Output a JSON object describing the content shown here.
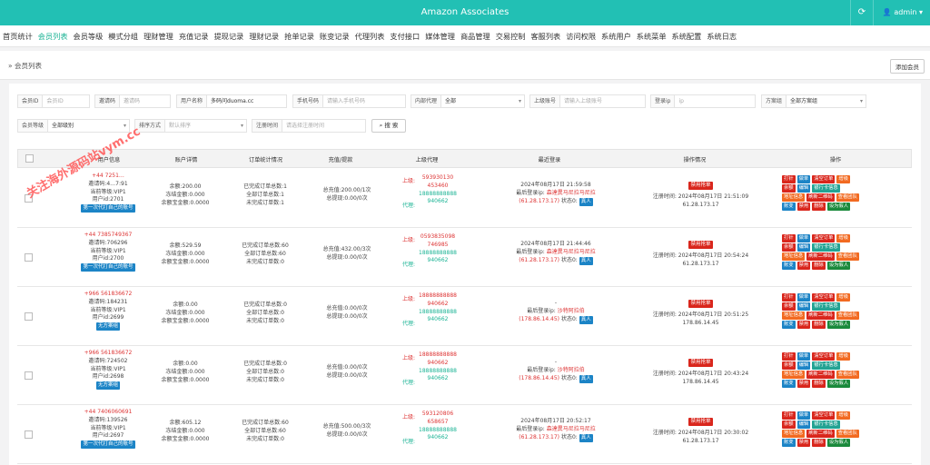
{
  "header": {
    "title": "Amazon Associates",
    "user": "admin",
    "refresh_icon": "refresh-icon",
    "user_icon": "user-icon"
  },
  "nav": [
    "首页统计",
    "会员列表",
    "会员等级",
    "模式分组",
    "理财管理",
    "充值记录",
    "提现记录",
    "理财记录",
    "抢单记录",
    "账变记录",
    "代理列表",
    "支付接口",
    "媒体管理",
    "商品管理",
    "交易控制",
    "客服列表",
    "访问权限",
    "系统用户",
    "系统菜单",
    "系统配置",
    "系统日志"
  ],
  "nav_active": 1,
  "breadcrumb": {
    "title": "会员列表",
    "add_button": "添加会员"
  },
  "filters": {
    "member_id": {
      "label": "会员ID",
      "placeholder": "会员ID"
    },
    "invite_code": {
      "label": "邀请码",
      "placeholder": "邀请码"
    },
    "user_name": {
      "label": "用户名称",
      "value": "多码问duoma.cc"
    },
    "phone": {
      "label": "手机号码",
      "placeholder": "请输入手机号码"
    },
    "internal_agent": {
      "label": "内部代理",
      "value": "全部"
    },
    "parent_phone": {
      "label": "上级账号",
      "placeholder": "请输入上级账号"
    },
    "login_ip": {
      "label": "登录ip",
      "placeholder": "ip"
    },
    "plan_group": {
      "label": "方案组",
      "value": "全部方案组"
    },
    "member_level": {
      "label": "会员等级",
      "value": "全部级别"
    },
    "sort": {
      "label": "排序方式",
      "placeholder": "默认排序"
    },
    "reg_time": {
      "label": "注册时间",
      "placeholder": "请选择注册时间"
    },
    "search_button": "搜 索"
  },
  "columns": [
    "用户信息",
    "账户详情",
    "订单统计情况",
    "充值/提款",
    "上级代理",
    "最近登录",
    "操作情况",
    "操作"
  ],
  "watermark": "关注海外源码站vym.cc",
  "rows": [
    {
      "phone": "+44 7251…",
      "invite": "邀请码:4…7:91",
      "level": "当前等级:VIP1",
      "uid": "用户id:2701",
      "tag": "第一次代打自己的账号",
      "acct": [
        "余额:200.00",
        "冻结金额:0.000",
        "余额宝金额:0.0000"
      ],
      "orders": [
        "已完成订单总数:1",
        "全部订单总数:1",
        "未完成订单数:1"
      ],
      "money": [
        "总充值:200.00/1次",
        "总提现:0.00/0次"
      ],
      "parent": [
        "593930130",
        "453460"
      ],
      "agent": [
        "18888888888",
        "940662"
      ],
      "last": "2024年08月17日 21:59:58",
      "login_ip": "森達異马尼拉马尼拉",
      "ip": "(61.28.173.17)",
      "state": "状态0:",
      "state_tag": "真人",
      "ban": "禁用抢单",
      "reg": "注册时间: 2024年08月17日 21:51:09",
      "reg_ip": "61.28.173.17"
    },
    {
      "phone": "+44 7385749367",
      "invite": "邀请码:706296",
      "level": "当前等级:VIP1",
      "uid": "用户id:2700",
      "tag": "第一次代打自己的账号",
      "acct": [
        "余额:529.59",
        "冻结金额:0.000",
        "余额宝金额:0.0000"
      ],
      "orders": [
        "已完成订单总数:60",
        "全部订单总数:60",
        "未完成订单数:0"
      ],
      "money": [
        "总充值:432.00/3次",
        "总提现:0.00/0次"
      ],
      "parent": [
        "0593835098",
        "746985"
      ],
      "agent": [
        "18888888888",
        "940662"
      ],
      "last": "2024年08月17日 21:44:46",
      "login_ip": "森達異马尼拉马尼拉",
      "ip": "(61.28.173.17)",
      "state": "状态0:",
      "state_tag": "真人",
      "ban": "禁用抢单",
      "reg": "注册时间: 2024年08月17日 20:54:24",
      "reg_ip": "61.28.173.17"
    },
    {
      "phone": "+966 561836672",
      "invite": "邀请码:184231",
      "level": "当前等级:VIP1",
      "uid": "用户id:2699",
      "tag": "无方案组",
      "acct": [
        "余额:0.00",
        "冻结金额:0.000",
        "余额宝金额:0.0000"
      ],
      "orders": [
        "已完成订单总数:0",
        "全部订单总数:0",
        "未完成订单数:0"
      ],
      "money": [
        "总充值:0.00/0次",
        "总提现:0.00/0次"
      ],
      "parent": [
        "18888888888",
        "940662"
      ],
      "agent": [
        "18888888888",
        "940662"
      ],
      "last": "-",
      "login_ip": "沙特阿拉伯",
      "ip": "(178.86.14.45)",
      "state": "状态0:",
      "state_tag": "真人",
      "ban": "禁用抢单",
      "reg": "注册时间: 2024年08月17日 20:51:25",
      "reg_ip": "178.86.14.45"
    },
    {
      "phone": "+966 561836672",
      "invite": "邀请码:724502",
      "level": "当前等级:VIP1",
      "uid": "用户id:2698",
      "tag": "无方案组",
      "acct": [
        "余额:0.00",
        "冻结金额:0.000",
        "余额宝金额:0.0000"
      ],
      "orders": [
        "已完成订单总数:0",
        "全部订单总数:0",
        "未完成订单数:0"
      ],
      "money": [
        "总充值:0.00/0次",
        "总提现:0.00/0次"
      ],
      "parent": [
        "18888888888",
        "940662"
      ],
      "agent": [
        "18888888888",
        "940662"
      ],
      "last": "-",
      "login_ip": "沙特阿拉伯",
      "ip": "(178.86.14.45)",
      "state": "状态0:",
      "state_tag": "真人",
      "ban": "禁用抢单",
      "reg": "注册时间: 2024年08月17日 20:43:24",
      "reg_ip": "178.86.14.45"
    },
    {
      "phone": "+44 7406060691",
      "invite": "邀请码:139526",
      "level": "当前等级:VIP1",
      "uid": "用户id:2697",
      "tag": "第一次代打自己的账号",
      "acct": [
        "余额:605.12",
        "冻结金额:0.000",
        "余额宝金额:0.0000"
      ],
      "orders": [
        "已完成订单总数:60",
        "全部订单总数:60",
        "未完成订单数:0"
      ],
      "money": [
        "总充值:500.00/3次",
        "总提现:0.00/0次"
      ],
      "parent": [
        "593120806",
        "658657"
      ],
      "agent": [
        "18888888888",
        "940662"
      ],
      "last": "2024年08月17日 20:52:17",
      "login_ip": "森達異马尼拉马尼拉",
      "ip": "(61.28.173.17)",
      "state": "状态0:",
      "state_tag": "真人",
      "ban": "禁用抢单",
      "reg": "注册时间: 2024年08月17日 20:30:02",
      "reg_ip": "61.28.173.17"
    }
  ],
  "labels": {
    "parent": "上级:",
    "agent": "代理:",
    "last_ip": "最后登录ip:"
  },
  "action_buttons": [
    [
      {
        "t": "打针",
        "c": "r"
      },
      {
        "t": "做单",
        "c": "b1"
      },
      {
        "t": "清空订单",
        "c": "r"
      },
      {
        "t": "增级",
        "c": "o"
      }
    ],
    [
      {
        "t": "余额",
        "c": "r"
      },
      {
        "t": "编辑",
        "c": "b1"
      },
      {
        "t": "银行卡信息",
        "c": "t"
      }
    ],
    [
      {
        "t": "地址信息",
        "c": "o"
      },
      {
        "t": "刷新二维码",
        "c": "r"
      },
      {
        "t": "查看团队",
        "c": "o"
      }
    ],
    [
      {
        "t": "账变",
        "c": "b1"
      },
      {
        "t": "禁用",
        "c": "r"
      },
      {
        "t": "删除",
        "c": "r"
      },
      {
        "t": "设为假人",
        "c": "g"
      }
    ]
  ]
}
